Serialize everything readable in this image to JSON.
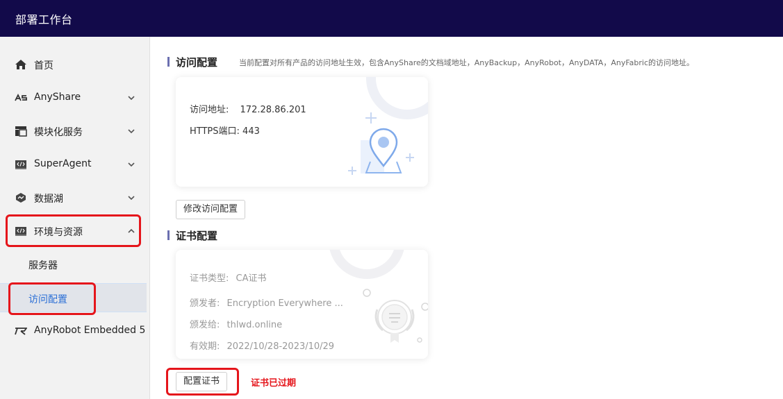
{
  "header": {
    "title": "部署工作台"
  },
  "sidebar": {
    "items": [
      {
        "label": "首页",
        "icon": "home-icon"
      },
      {
        "label": "AnyShare",
        "icon": "anyshare-logo-icon"
      },
      {
        "label": "模块化服务",
        "icon": "layout-icon"
      },
      {
        "label": "SuperAgent",
        "icon": "code-icon"
      },
      {
        "label": "数据湖",
        "icon": "datalake-icon"
      },
      {
        "label": "环境与资源",
        "icon": "code-icon"
      },
      {
        "label": "AnyRobot Embedded 5",
        "icon": "anyrobot-logo-icon"
      }
    ],
    "sub_items": [
      {
        "label": "服务器"
      },
      {
        "label": "访问配置"
      }
    ]
  },
  "access_section": {
    "title": "访问配置",
    "description": "当前配置对所有产品的访问地址生效，包含AnyShare的文档域地址，AnyBackup，AnyRobot，AnyDATA，AnyFabric的访问地址。",
    "address_label": "访问地址:",
    "address_value": "172.28.86.201",
    "https_label": "HTTPS端口:",
    "https_value": "443",
    "modify_button": "修改访问配置"
  },
  "cert_section": {
    "title": "证书配置",
    "type_label": "证书类型:",
    "type_value": "CA证书",
    "issuer_label": "颁发者:",
    "issuer_value": "Encryption Everywhere ...",
    "issued_to_label": "颁发给:",
    "issued_to_value": "thlwd.online",
    "validity_label": "有效期:",
    "validity_value": "2022/10/28-2023/10/29",
    "config_button": "配置证书",
    "expired_note": "证书已过期"
  },
  "colors": {
    "header_bg": "#120a4a",
    "highlight_red": "#e5151b",
    "active_link": "#2b6fd6",
    "section_bar": "#6b6fb0"
  }
}
